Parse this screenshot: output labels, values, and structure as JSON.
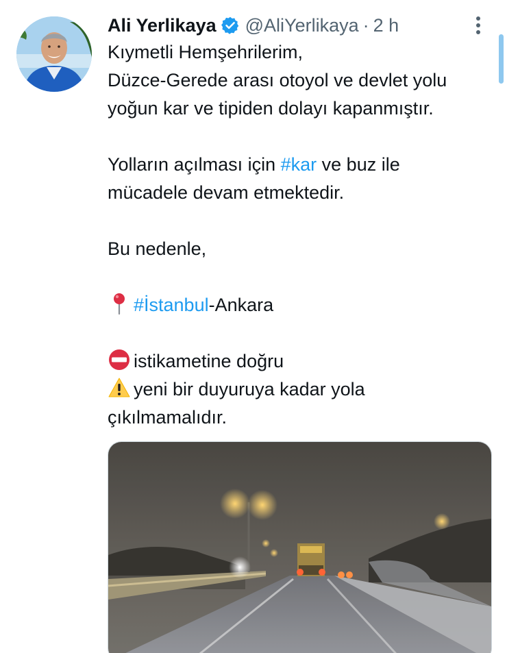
{
  "tweet": {
    "display_name": "Ali Yerlikaya",
    "handle": "@AliYerlikaya",
    "separator": "·",
    "time": "2 h",
    "verified": true,
    "accent_color": "#1d9bf0",
    "body": {
      "line1": "Kıymetli Hemşehrilerim,",
      "line2": "Düzce-Gerede arası otoyol ve devlet yolu",
      "line3": "yoğun kar ve tipiden dolayı kapanmıştır.",
      "line4_pre": "Yolların açılması için ",
      "line4_hashtag": "#kar",
      "line4_post": " ve buz ile",
      "line5": "mücadele devam etmektedir.",
      "line6": "Bu nedenle,",
      "line7_hashtag": "#İstanbul",
      "line7_post": "-Ankara",
      "line8": "istikametine doğru",
      "line9": "yeni bir duyuruya kadar yola",
      "line10": "çıkılmamalıdır."
    },
    "icons": {
      "verified": "verified-badge-icon",
      "more": "more-options-icon",
      "pin": "round-pushpin-emoji",
      "no_entry": "no-entry-emoji",
      "warning": "warning-emoji"
    },
    "media": {
      "type": "video-thumbnail"
    }
  }
}
